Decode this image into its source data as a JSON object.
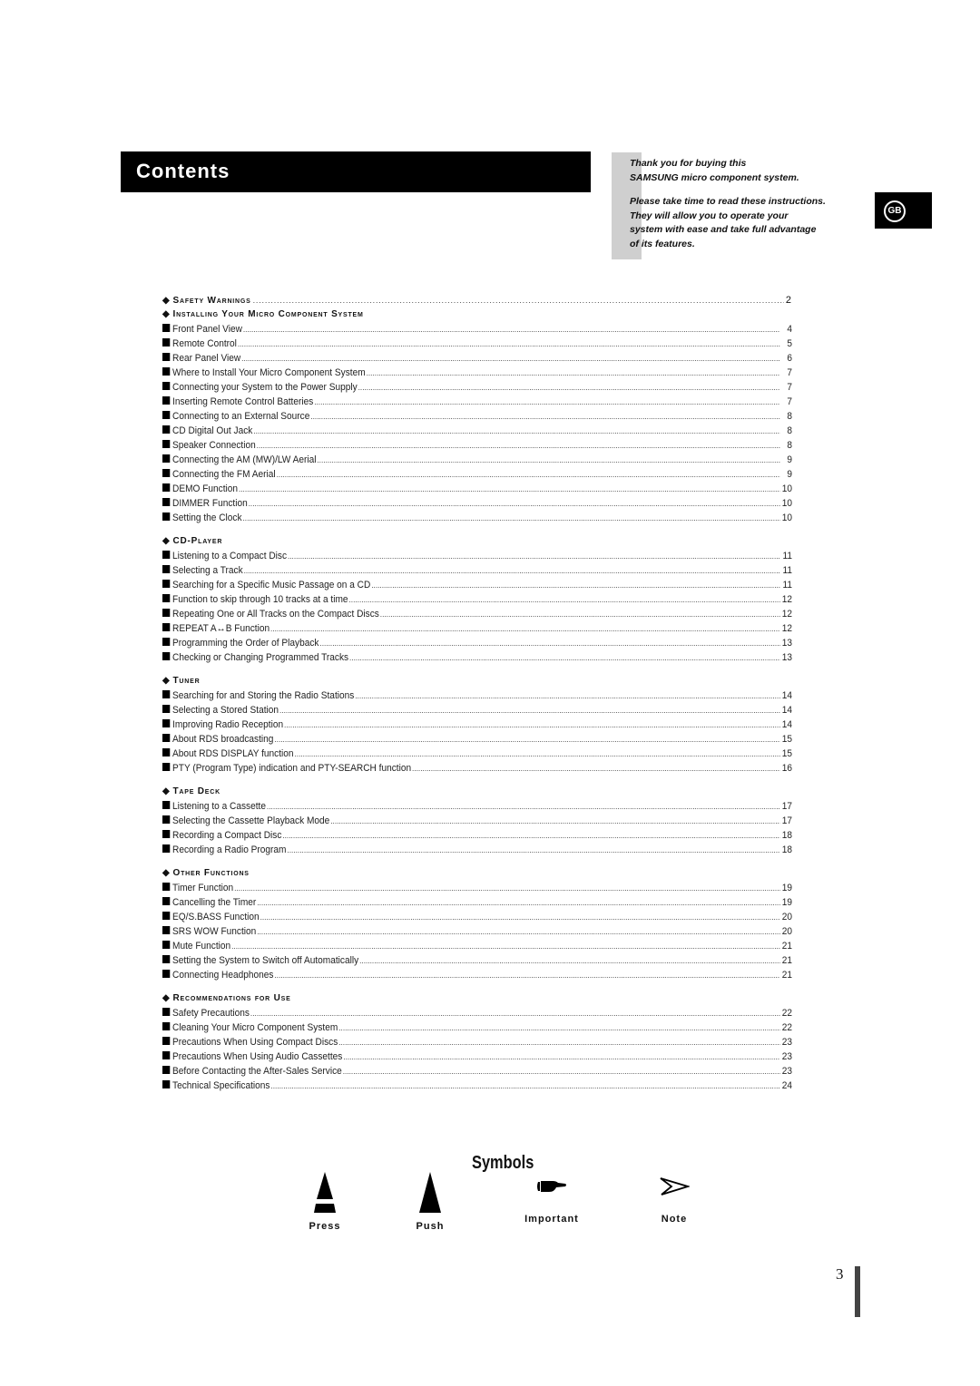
{
  "header": {
    "title": "Contents",
    "intro_line1": "Thank you for buying this",
    "intro_line2": "SAMSUNG micro component system.",
    "intro_line3": "Please take time to read these instructions.",
    "intro_line4": "They will allow you to operate your",
    "intro_line5": "system with ease and take full advantage",
    "intro_line6": "of its features.",
    "language_badge": "GB"
  },
  "toc": {
    "sections": [
      {
        "title": "Safety Warnings",
        "page": "2",
        "items": []
      },
      {
        "title": "Installing Your Micro Component System",
        "page": "",
        "items": [
          {
            "label": "Front Panel View",
            "page": "4"
          },
          {
            "label": "Remote Control",
            "page": "5"
          },
          {
            "label": "Rear Panel View",
            "page": "6"
          },
          {
            "label": "Where to Install Your Micro Component System",
            "page": "7"
          },
          {
            "label": "Connecting your System to the Power Supply",
            "page": "7"
          },
          {
            "label": "Inserting Remote Control Batteries",
            "page": "7"
          },
          {
            "label": "Connecting to an External Source",
            "page": "8"
          },
          {
            "label": "CD Digital Out Jack",
            "page": "8"
          },
          {
            "label": "Speaker Connection",
            "page": "8"
          },
          {
            "label": "Connecting the AM (MW)/LW Aerial",
            "page": "9"
          },
          {
            "label": "Connecting the FM Aerial",
            "page": "9"
          },
          {
            "label": "DEMO Function",
            "page": "10"
          },
          {
            "label": "DIMMER Function",
            "page": "10"
          },
          {
            "label": "Setting the Clock",
            "page": "10"
          }
        ]
      },
      {
        "title": "CD-Player",
        "page": "",
        "items": [
          {
            "label": "Listening to a Compact Disc",
            "page": "11"
          },
          {
            "label": "Selecting a Track",
            "page": "11"
          },
          {
            "label": "Searching for a Specific Music Passage on a CD",
            "page": "11"
          },
          {
            "label": "Function to skip through 10 tracks at a time",
            "page": "12"
          },
          {
            "label": "Repeating One or All Tracks on the Compact Discs",
            "page": "12"
          },
          {
            "label": "REPEAT A↔B Function",
            "page": "12"
          },
          {
            "label": "Programming the Order of Playback",
            "page": "13"
          },
          {
            "label": "Checking or Changing Programmed Tracks",
            "page": "13"
          }
        ]
      },
      {
        "title": "Tuner",
        "page": "",
        "items": [
          {
            "label": "Searching for and Storing the Radio Stations",
            "page": "14"
          },
          {
            "label": "Selecting a Stored Station",
            "page": "14"
          },
          {
            "label": "Improving Radio Reception",
            "page": "14"
          },
          {
            "label": "About RDS broadcasting",
            "page": "15"
          },
          {
            "label": "About RDS DISPLAY function",
            "page": "15"
          },
          {
            "label": "PTY (Program Type) indication and PTY-SEARCH function",
            "page": "16"
          }
        ]
      },
      {
        "title": "Tape Deck",
        "page": "",
        "items": [
          {
            "label": "Listening to a Cassette",
            "page": "17"
          },
          {
            "label": "Selecting the Cassette Playback Mode",
            "page": "17"
          },
          {
            "label": "Recording a Compact Disc",
            "page": "18"
          },
          {
            "label": "Recording a Radio Program",
            "page": "18"
          }
        ]
      },
      {
        "title": "Other Functions",
        "page": "",
        "items": [
          {
            "label": "Timer Function",
            "page": "19"
          },
          {
            "label": "Cancelling the Timer",
            "page": "19"
          },
          {
            "label": "EQ/S.BASS Function",
            "page": "20"
          },
          {
            "label": "SRS WOW Function",
            "page": "20"
          },
          {
            "label": "Mute Function",
            "page": "21"
          },
          {
            "label": "Setting the System to Switch off Automatically",
            "page": "21"
          },
          {
            "label": "Connecting Headphones",
            "page": "21"
          }
        ]
      },
      {
        "title": "Recommendations for Use",
        "page": "",
        "items": [
          {
            "label": "Safety Precautions",
            "page": "22"
          },
          {
            "label": "Cleaning Your Micro Component System",
            "page": "22"
          },
          {
            "label": "Precautions When Using Compact Discs",
            "page": "23"
          },
          {
            "label": "Precautions When Using Audio Cassettes",
            "page": "23"
          },
          {
            "label": "Before Contacting the After-Sales Service",
            "page": "23"
          },
          {
            "label": "Technical Specifications",
            "page": "24"
          }
        ]
      }
    ]
  },
  "symbols": {
    "title": "Symbols",
    "items": [
      {
        "label": "Press",
        "icon": "press-icon"
      },
      {
        "label": "Push",
        "icon": "push-icon"
      },
      {
        "label": "Important",
        "icon": "pointing-hand-icon"
      },
      {
        "label": "Note",
        "icon": "arrow-note-icon"
      }
    ]
  },
  "footer": {
    "page_number": "3"
  }
}
